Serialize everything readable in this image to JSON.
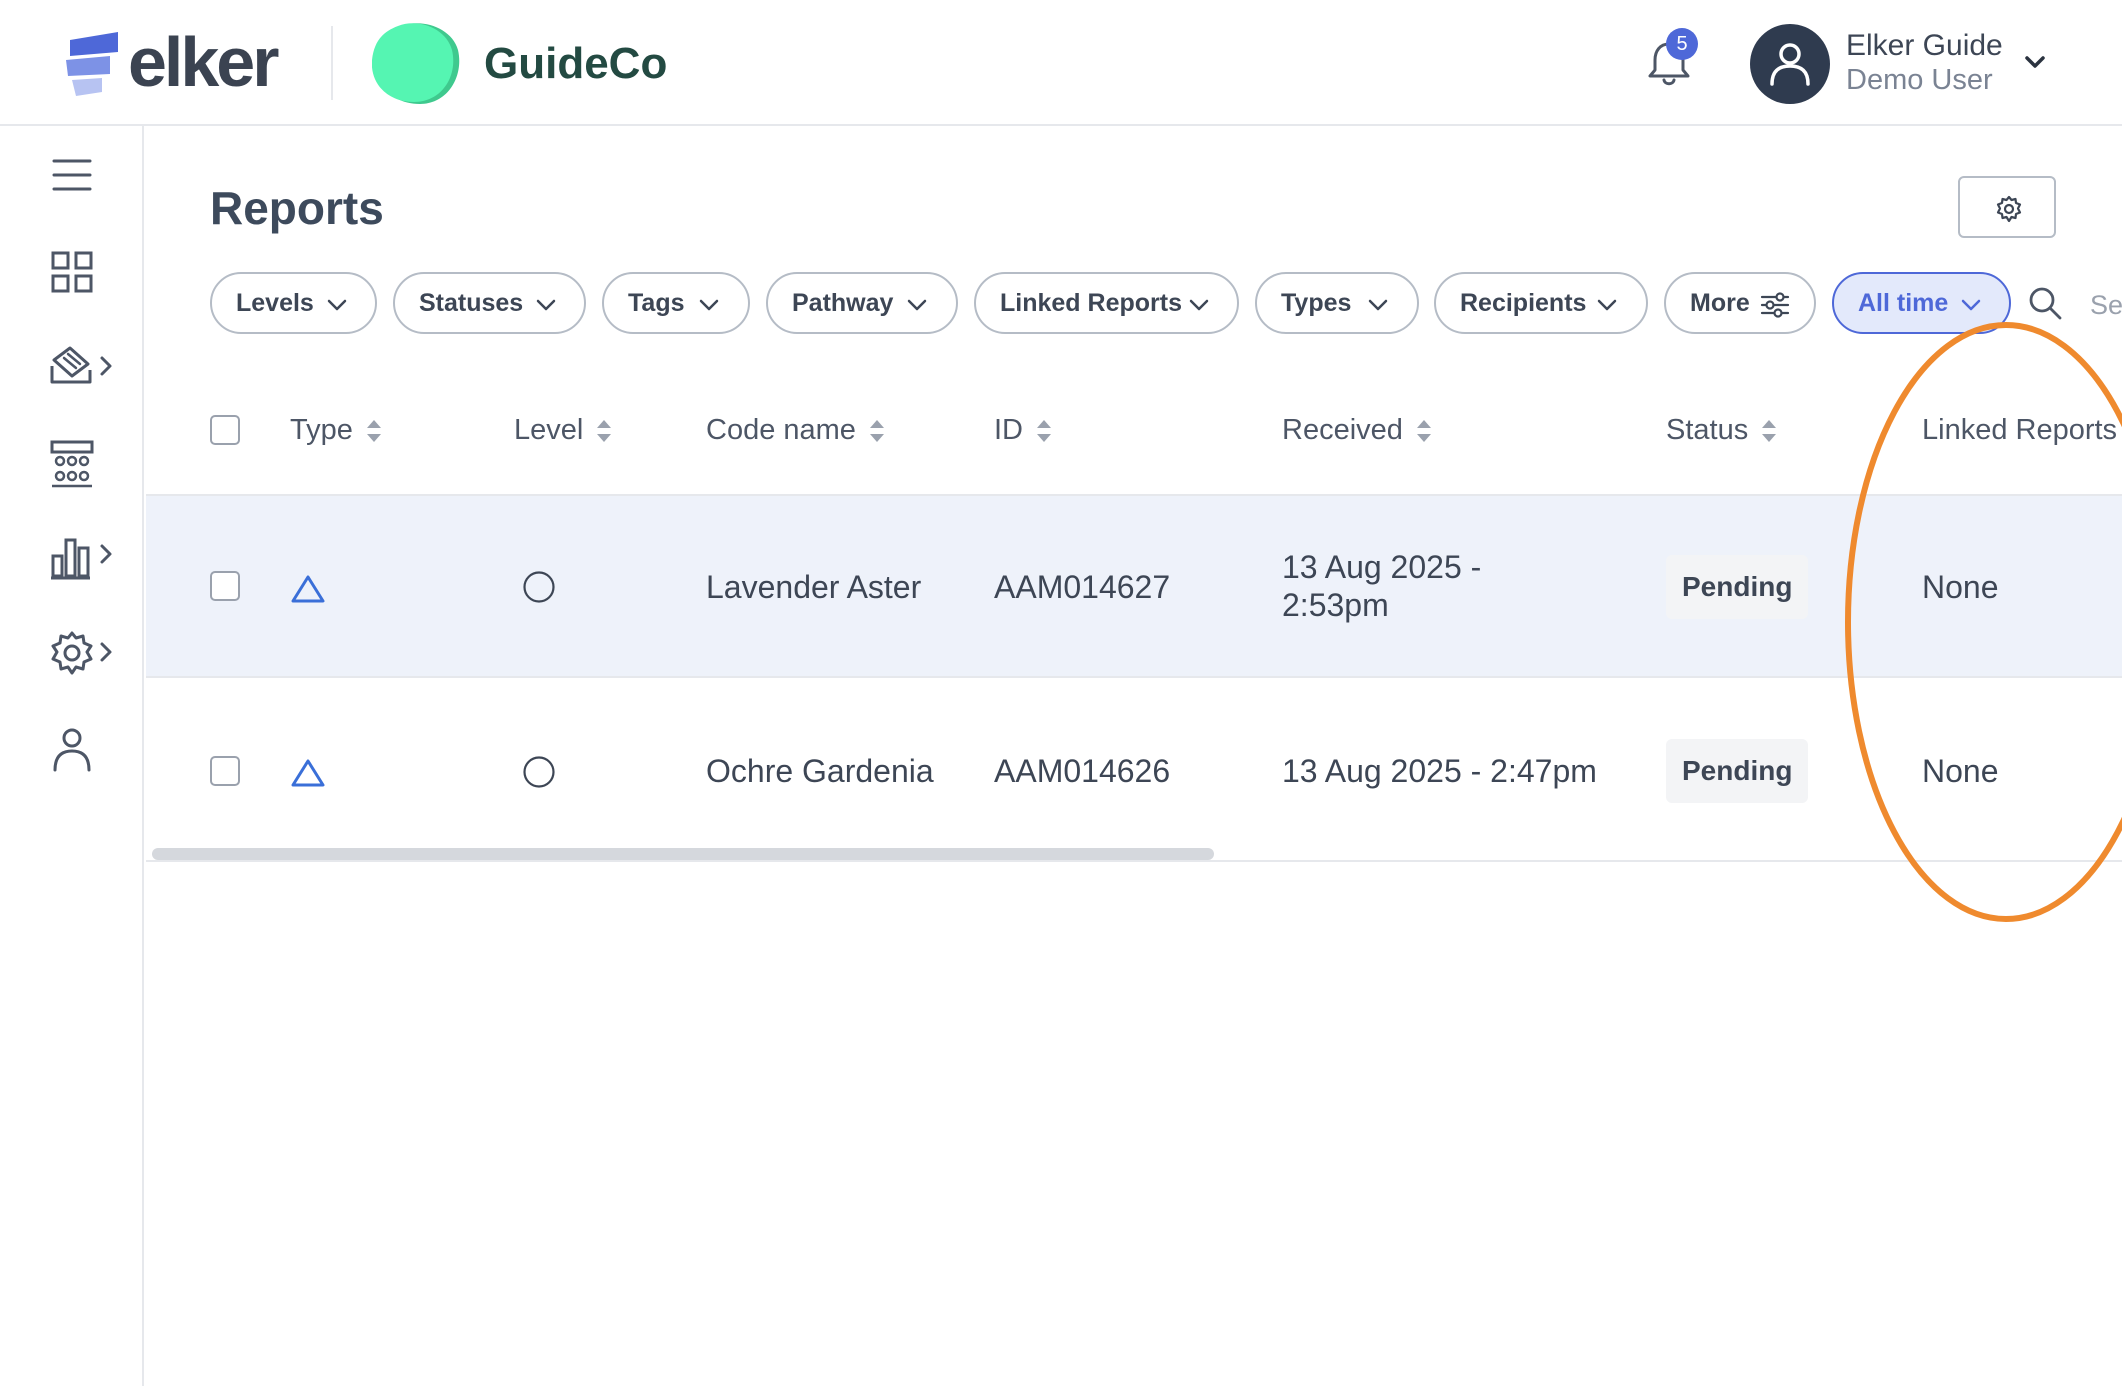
{
  "brand": {
    "name": "elker",
    "org_name": "GuideCo"
  },
  "header": {
    "notifications": {
      "count": "5",
      "icon": "bell-icon"
    },
    "user": {
      "name": "Elker Guide",
      "role": "Demo User",
      "icon": "user-avatar-icon"
    }
  },
  "sidebar": {
    "items": [
      {
        "icon": "menu-icon"
      },
      {
        "icon": "dashboard-grid-icon"
      },
      {
        "icon": "reports-icon",
        "expandable": true
      },
      {
        "icon": "team-icon"
      },
      {
        "icon": "analytics-bar-icon",
        "expandable": true
      },
      {
        "icon": "settings-gear-icon",
        "expandable": true
      },
      {
        "icon": "profile-icon"
      }
    ]
  },
  "page": {
    "title": "Reports"
  },
  "filters": {
    "levels": "Levels",
    "statuses": "Statuses",
    "tags": "Tags",
    "pathway": "Pathway",
    "linked_reports": "Linked Reports",
    "types": "Types",
    "recipients": "Recipients",
    "more": "More",
    "all_time": "All time",
    "search_placeholder": "Search"
  },
  "table": {
    "columns": {
      "type": "Type",
      "level": "Level",
      "code_name": "Code name",
      "id": "ID",
      "received": "Received",
      "status": "Status",
      "linked_reports": "Linked Reports"
    },
    "rows": [
      {
        "type_icon": "triangle-icon",
        "level_icon": "circle-icon",
        "code_name": "Lavender Aster",
        "id": "AAM014627",
        "received": "13 Aug 2025 - 2:53pm",
        "status": "Pending",
        "linked_reports": "None"
      },
      {
        "type_icon": "triangle-icon",
        "level_icon": "circle-icon",
        "code_name": "Ochre Gardenia",
        "id": "AAM014626",
        "received": "13 Aug 2025 - 2:47pm",
        "status": "Pending",
        "linked_reports": "None"
      }
    ]
  },
  "colors": {
    "accent": "#4e68d8",
    "org_green": "#4cf0a8",
    "highlight_orange": "#ef8a2e",
    "row_selected_bg": "#eef2fa"
  }
}
